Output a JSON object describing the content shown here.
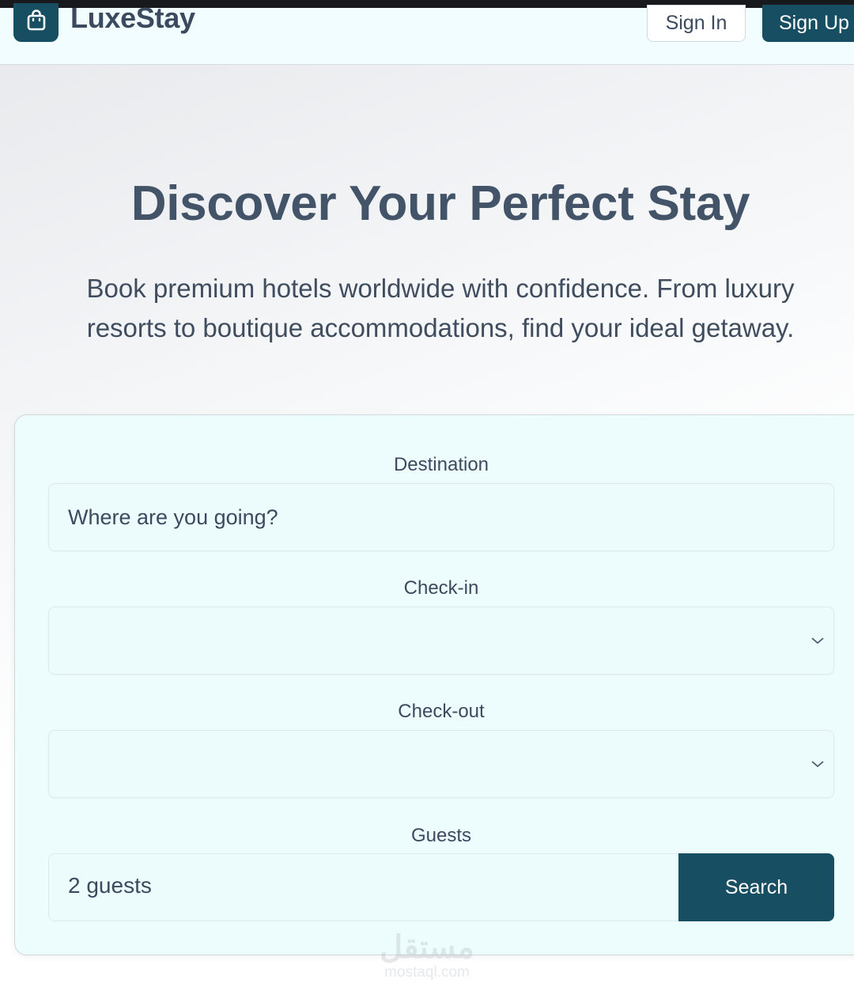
{
  "app": {
    "name": "LuxeStay"
  },
  "nav": {
    "sign_in": "Sign In",
    "sign_up": "Sign Up"
  },
  "hero": {
    "title": "Discover Your Perfect Stay",
    "subtitle_line1": "Book premium hotels worldwide with confidence. From luxury",
    "subtitle_line2": "resorts to boutique accommodations, find your ideal getaway."
  },
  "search": {
    "destination": {
      "label": "Destination",
      "placeholder": "Where are you going?",
      "value": ""
    },
    "check_in": {
      "label": "Check-in",
      "value": ""
    },
    "check_out": {
      "label": "Check-out",
      "value": ""
    },
    "guests": {
      "label": "Guests",
      "value": "2 guests"
    },
    "submit_label": "Search"
  },
  "watermark": {
    "arabic": "مستقل",
    "latin": "mostaql.com"
  },
  "colors": {
    "brand": "#184e62",
    "card_bg": "#edfdfe",
    "text": "#3b4a5e"
  },
  "icons": {
    "logo": "shopping-bag-icon",
    "date_dropdown": "chevron-down-icon"
  }
}
